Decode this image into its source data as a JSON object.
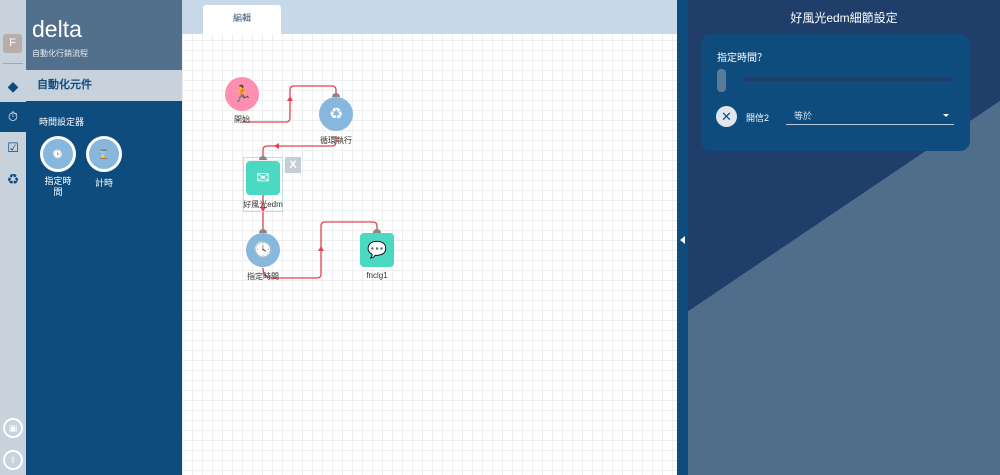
{
  "rail": {
    "avatar": "F"
  },
  "sidebar": {
    "title": "delta",
    "subtitle": "自動化行銷流程",
    "category": "自動化元件",
    "group": "時間設定器",
    "tools": [
      {
        "label": "指定時間"
      },
      {
        "label": "計時"
      }
    ]
  },
  "canvas": {
    "tab": "編輯",
    "nodes": [
      {
        "label": "開始"
      },
      {
        "label": "循環執行"
      },
      {
        "label": "好風光edm"
      },
      {
        "label": "指定時間"
      },
      {
        "label": "fnclg1"
      }
    ],
    "delete_label": "X"
  },
  "panel": {
    "title": "好風光edm細節設定",
    "question": "指定時間？",
    "field_label": "開信2",
    "select_value": "等於",
    "remove_label": "✕"
  },
  "colors": {
    "primary": "#0f4c7e",
    "start": "#ff8fb0",
    "node_blue": "#87b7dc",
    "node_teal": "#4bd9c3",
    "edge": "#e0444f"
  }
}
